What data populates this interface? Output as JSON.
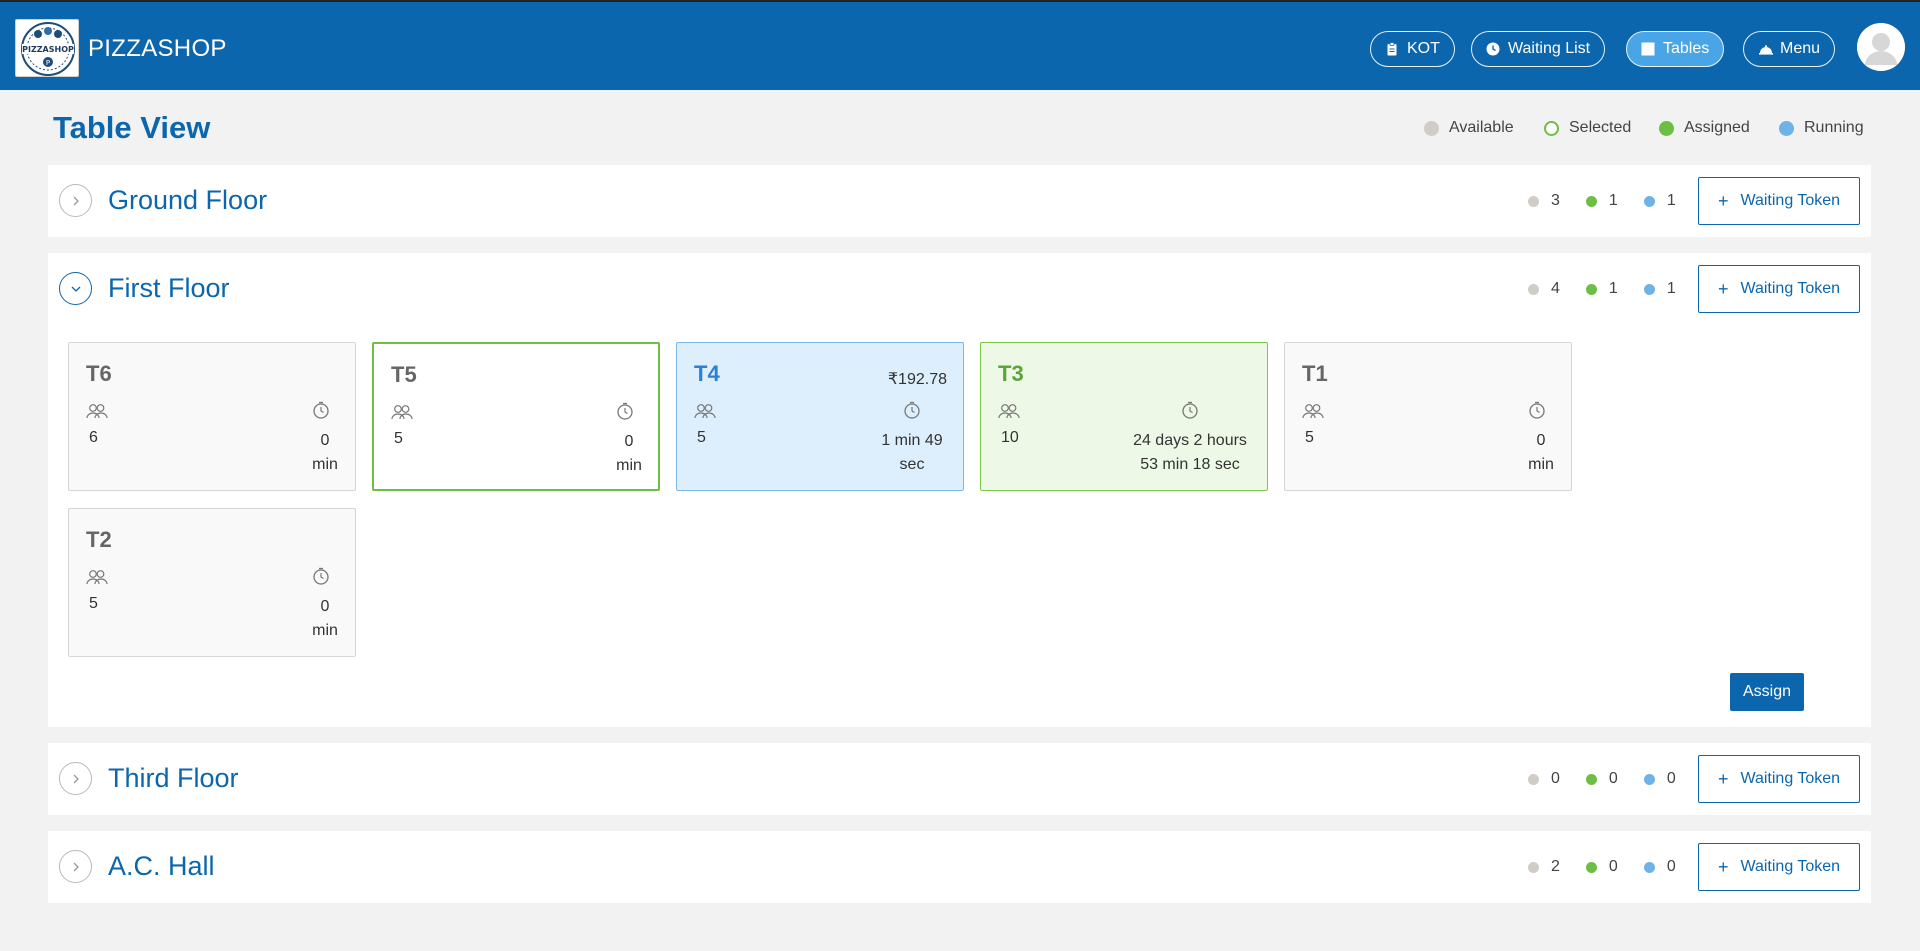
{
  "header": {
    "brand": "PIZZASHOP",
    "logo_text": "PIZZASHOP",
    "nav": [
      {
        "label": "KOT",
        "icon": "clipboard-icon",
        "active": false
      },
      {
        "label": "Waiting List",
        "icon": "clock-icon",
        "active": false
      },
      {
        "label": "Tables",
        "icon": "table-icon",
        "active": true
      },
      {
        "label": "Menu",
        "icon": "cloche-icon",
        "active": false
      }
    ],
    "accent": "#0b66ad"
  },
  "page": {
    "title": "Table View",
    "legend": [
      {
        "label": "Available",
        "color": "#d0ccc6"
      },
      {
        "label": "Selected",
        "color": "#6cbf43"
      },
      {
        "label": "Assigned",
        "color": "#6cbf43"
      },
      {
        "label": "Running",
        "color": "#6fb3e6"
      }
    ]
  },
  "floors": [
    {
      "name": "Ground Floor",
      "expanded": false,
      "available": "3",
      "assigned": "1",
      "running": "1",
      "button": "Waiting Token"
    },
    {
      "name": "First Floor",
      "expanded": true,
      "available": "4",
      "assigned": "1",
      "running": "1",
      "button": "Waiting Token"
    },
    {
      "name": "Third Floor",
      "expanded": false,
      "available": "0",
      "assigned": "0",
      "running": "0",
      "button": "Waiting Token"
    },
    {
      "name": "A.C. Hall",
      "expanded": false,
      "available": "2",
      "assigned": "0",
      "running": "0",
      "button": "Waiting Token"
    }
  ],
  "tables": [
    {
      "name": "T6",
      "status": "available",
      "capacity": "6",
      "time_line1": "0",
      "time_line2": "min",
      "amount": ""
    },
    {
      "name": "T5",
      "status": "selected",
      "capacity": "5",
      "time_line1": "0",
      "time_line2": "min",
      "amount": ""
    },
    {
      "name": "T4",
      "status": "running",
      "capacity": "5",
      "time_line1": "1 min 49",
      "time_line2": "sec",
      "amount": "₹192.78"
    },
    {
      "name": "T3",
      "status": "assigned",
      "capacity": "10",
      "time_line1": "24 days 2 hours",
      "time_line2": "53 min 18 sec",
      "amount": ""
    },
    {
      "name": "T1",
      "status": "available",
      "capacity": "5",
      "time_line1": "0",
      "time_line2": "min",
      "amount": ""
    },
    {
      "name": "T2",
      "status": "available",
      "capacity": "5",
      "time_line1": "0",
      "time_line2": "min",
      "amount": ""
    }
  ],
  "assign_label": "Assign"
}
